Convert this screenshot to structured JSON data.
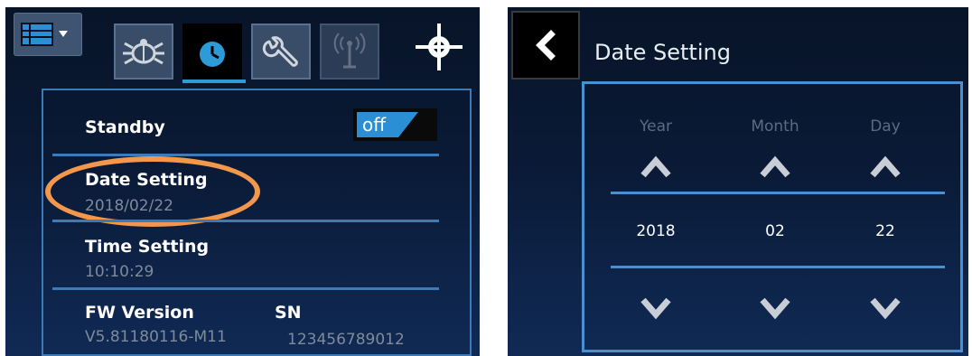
{
  "left_screen": {
    "toolbar": {
      "menu_icon": "list-menu-icon",
      "tabs": [
        {
          "icon": "bug-icon",
          "active": false
        },
        {
          "icon": "clock-icon",
          "active": true
        },
        {
          "icon": "wrench-icon",
          "active": false
        },
        {
          "icon": "antenna-icon",
          "active": false
        }
      ],
      "target_icon": "crosshair-icon"
    },
    "standby": {
      "label": "Standby",
      "toggle_text": "off"
    },
    "date_setting": {
      "label": "Date Setting",
      "value": "2018/02/22"
    },
    "time_setting": {
      "label": "Time Setting",
      "value": "10:10:29"
    },
    "fw_version": {
      "label": "FW Version",
      "value": "V5.81180116-M11"
    },
    "sn": {
      "label": "SN",
      "value": "123456789012"
    }
  },
  "right_screen": {
    "title": "Date Setting",
    "columns": [
      {
        "label": "Year",
        "value": "2018"
      },
      {
        "label": "Month",
        "value": "02"
      },
      {
        "label": "Day",
        "value": "22"
      }
    ]
  },
  "colors": {
    "accent_blue": "#2b8fd6",
    "panel_border": "#3d7bb8",
    "highlight_oval": "#f2974b"
  }
}
